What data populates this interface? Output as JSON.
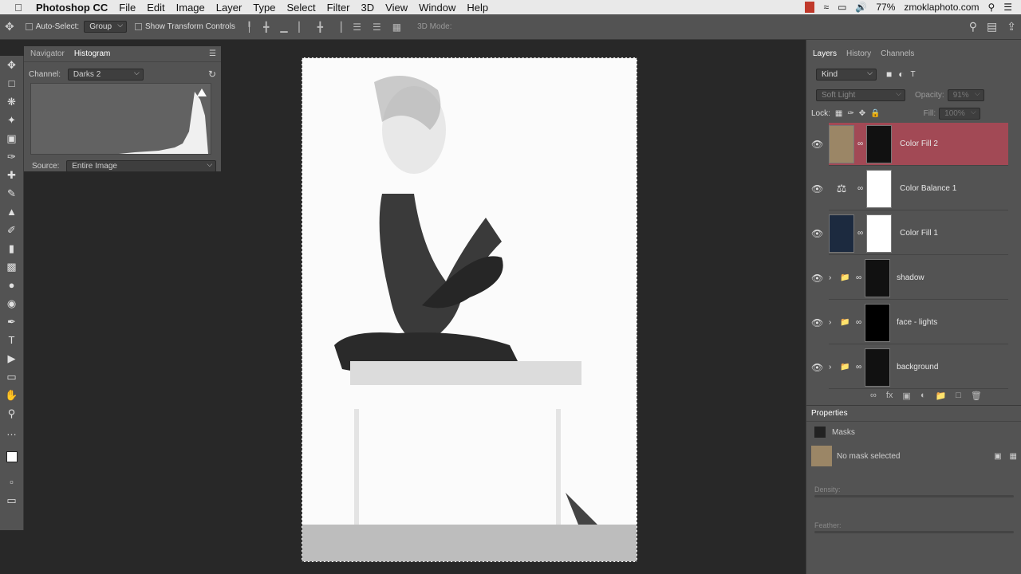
{
  "menubar": {
    "app": "Photoshop CC",
    "items": [
      "File",
      "Edit",
      "Image",
      "Layer",
      "Type",
      "Select",
      "Filter",
      "3D",
      "View",
      "Window",
      "Help"
    ],
    "battery": "77%",
    "site": "zmoklaphoto.com"
  },
  "options": {
    "auto_select_label": "Auto-Select:",
    "auto_select_value": "Group",
    "transform_label": "Show Transform Controls",
    "mode_3d": "3D Mode:"
  },
  "navigator": {
    "tabs": [
      "Navigator",
      "Histogram"
    ],
    "channel_label": "Channel:",
    "channel_value": "Darks 2",
    "source_label": "Source:",
    "source_value": "Entire Image"
  },
  "layers": {
    "tabs": [
      "Layers",
      "History",
      "Channels"
    ],
    "filter": "Kind",
    "blend": "Soft Light",
    "opacity_label": "Opacity:",
    "opacity_value": "91%",
    "lock_label": "Lock:",
    "fill_label": "Fill:",
    "fill_value": "100%",
    "items": [
      {
        "name": "Color Fill 2",
        "selected": true,
        "thumb": "#9b8666"
      },
      {
        "name": "Color Balance 1",
        "selected": false,
        "thumb": "balance"
      },
      {
        "name": "Color Fill 1",
        "selected": false,
        "thumb": "#1c2a3f"
      },
      {
        "name": "shadow",
        "selected": false,
        "thumb": "folder"
      },
      {
        "name": "face - lights",
        "selected": false,
        "thumb": "folder"
      },
      {
        "name": "background",
        "selected": false,
        "thumb": "folder"
      }
    ]
  },
  "properties": {
    "title": "Properties",
    "section": "Masks",
    "status": "No mask selected",
    "density_label": "Density:",
    "feather_label": "Feather:"
  }
}
